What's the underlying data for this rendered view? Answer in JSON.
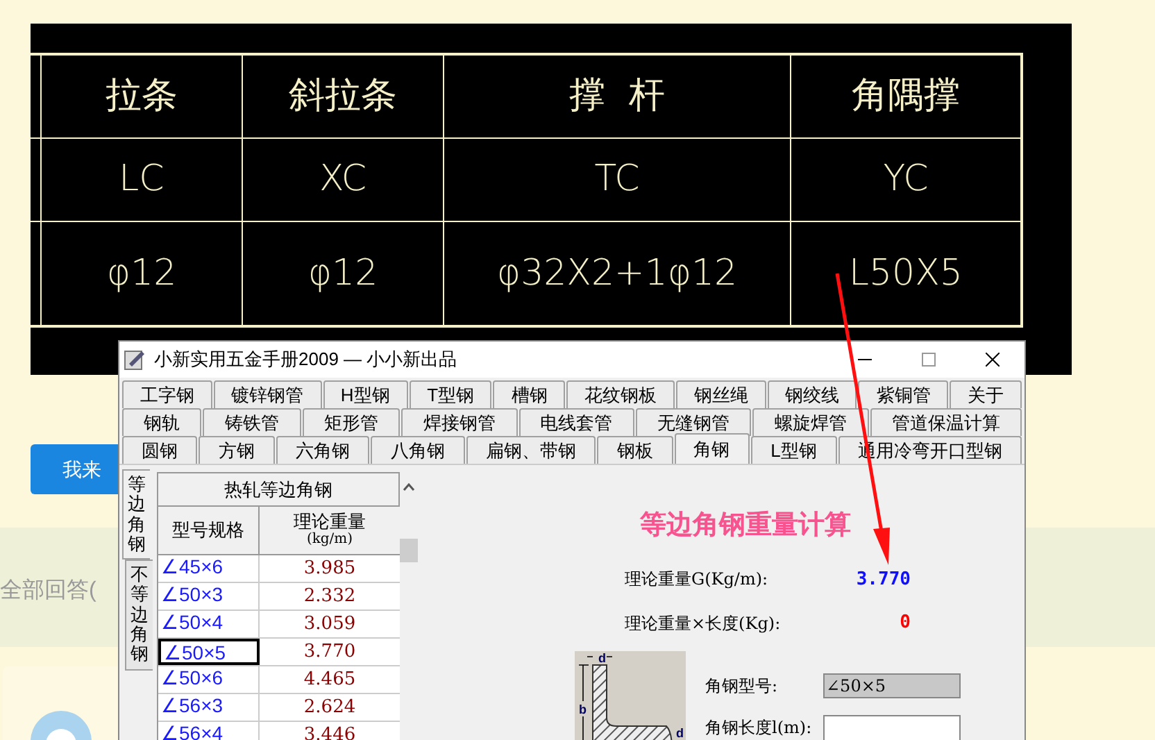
{
  "cad_table": {
    "rows": [
      [
        "拉条",
        "斜拉条",
        "撑  杆",
        "角隅撑"
      ],
      [
        "LC",
        "XC",
        "TC",
        "YC"
      ],
      [
        "φ12",
        "φ12",
        "φ32X2+1φ12",
        "L50X5"
      ]
    ]
  },
  "page": {
    "answer_button": "我来",
    "answers_heading": "全部回答("
  },
  "window": {
    "title": "小新实用五金手册2009 — 小小新出品"
  },
  "tab_rows": [
    [
      {
        "label": "工字钢",
        "selected": false
      },
      {
        "label": "镀锌钢管",
        "selected": false
      },
      {
        "label": "H型钢",
        "selected": false
      },
      {
        "label": "T型钢",
        "selected": false
      },
      {
        "label": "槽钢",
        "selected": false
      },
      {
        "label": "花纹钢板",
        "selected": false
      },
      {
        "label": "钢丝绳",
        "selected": false
      },
      {
        "label": "钢绞线",
        "selected": false
      },
      {
        "label": "紫铜管",
        "selected": false
      },
      {
        "label": "关于",
        "selected": false
      }
    ],
    [
      {
        "label": "钢轨",
        "selected": false
      },
      {
        "label": "铸铁管",
        "selected": false
      },
      {
        "label": "矩形管",
        "selected": false
      },
      {
        "label": "焊接钢管",
        "selected": false
      },
      {
        "label": "电线套管",
        "selected": false
      },
      {
        "label": "无缝钢管",
        "selected": false
      },
      {
        "label": "螺旋焊管",
        "selected": false
      },
      {
        "label": "管道保温计算",
        "selected": false
      }
    ],
    [
      {
        "label": "圆钢",
        "selected": false
      },
      {
        "label": "方钢",
        "selected": false
      },
      {
        "label": "六角钢",
        "selected": false
      },
      {
        "label": "八角钢",
        "selected": false
      },
      {
        "label": "扁钢、带钢",
        "selected": false
      },
      {
        "label": "钢板",
        "selected": false
      },
      {
        "label": "角钢",
        "selected": true
      },
      {
        "label": "L型钢",
        "selected": false
      },
      {
        "label": "通用冷弯开口型钢",
        "selected": false
      }
    ]
  ],
  "side_tabs": [
    {
      "label": "等边角钢",
      "selected": true
    },
    {
      "label": "不等边角钢",
      "selected": false
    }
  ],
  "table": {
    "title": "热轧等边角钢",
    "columns": [
      {
        "label": "型号规格"
      },
      {
        "label": "理论重量",
        "unit": "(kg/m)"
      }
    ],
    "rows": [
      {
        "spec": "∠45×6",
        "weight": "3.985",
        "selected": false
      },
      {
        "spec": "∠50×3",
        "weight": "2.332",
        "selected": false
      },
      {
        "spec": "∠50×4",
        "weight": "3.059",
        "selected": false
      },
      {
        "spec": "∠50×5",
        "weight": "3.770",
        "selected": true
      },
      {
        "spec": "∠50×6",
        "weight": "4.465",
        "selected": false
      },
      {
        "spec": "∠56×3",
        "weight": "2.624",
        "selected": false
      },
      {
        "spec": "∠56×4",
        "weight": "3.446",
        "selected": false
      }
    ]
  },
  "calculator": {
    "title": "等边角钢重量计算",
    "weight_label": "理论重量G(Kg/m):",
    "weight_value": "3.770",
    "total_label": "理论重量×长度(Kg):",
    "total_value": "0",
    "diagram_labels": {
      "top_thickness": "d",
      "width": "b",
      "side_thickness": "d"
    },
    "model_label": "角钢型号:",
    "model_value": "∠50×5",
    "length_label": "角钢长度l(m):"
  }
}
